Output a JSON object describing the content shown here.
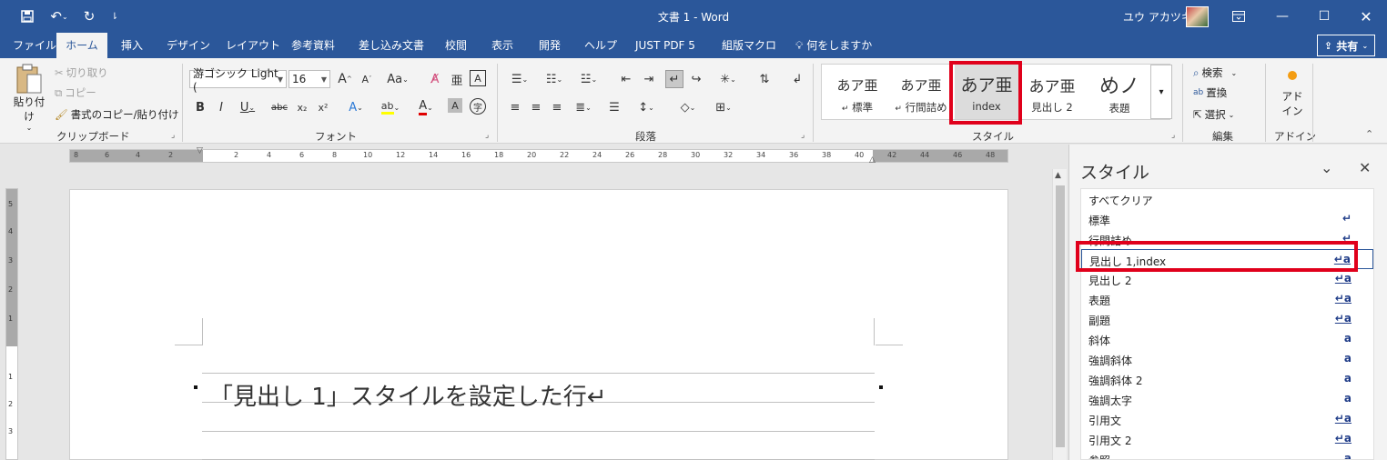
{
  "titlebar": {
    "doc_title": "文書 1  -  Word",
    "user": "ユウ アカツキ",
    "qa_icons": [
      "save-icon",
      "undo-icon",
      "redo-icon",
      "customize-icon"
    ],
    "window_buttons": [
      "ribbon-display-icon",
      "minimize-icon",
      "maximize-icon",
      "close-icon"
    ]
  },
  "tabs": [
    "ファイル",
    "ホーム",
    "挿入",
    "デザイン",
    "レイアウト",
    "参考資料",
    "差し込み文書",
    "校閲",
    "表示",
    "開発",
    "ヘルプ",
    "JUST PDF 5",
    "組版マクロ",
    "何をしますか"
  ],
  "active_tab": "ホーム",
  "share_label": "共有",
  "ribbon": {
    "clipboard": {
      "paste": "貼り付け",
      "cut": "切り取り",
      "copy": "コピー",
      "format_painter": "書式のコピー/貼り付け",
      "group_label": "クリップボード"
    },
    "font": {
      "font_name": "游ゴシック Light (",
      "font_size": "16",
      "group_label": "フォント"
    },
    "paragraph": {
      "group_label": "段落"
    },
    "styles": {
      "group_label": "スタイル",
      "gallery": [
        {
          "preview": "あア亜",
          "name": "標準"
        },
        {
          "preview": "あア亜",
          "name": "行間詰め"
        },
        {
          "preview": "あア亜",
          "name": "index"
        },
        {
          "preview": "あア亜",
          "name": "見出し 2"
        },
        {
          "preview": "めノ",
          "name": "表題"
        }
      ]
    },
    "editing": {
      "find": "検索",
      "replace": "置換",
      "select": "選択",
      "group_label": "編集"
    },
    "addin": {
      "label1": "アド",
      "label2": "イン",
      "group_label": "アドイン"
    }
  },
  "ruler": {
    "left_ticks": [
      "8",
      "6",
      "4",
      "2"
    ],
    "ticks": [
      "2",
      "4",
      "6",
      "8",
      "10",
      "12",
      "14",
      "16",
      "18",
      "20",
      "22",
      "24",
      "26",
      "28",
      "30",
      "32",
      "34",
      "36",
      "38",
      "40"
    ],
    "right_ticks": [
      "42",
      "44",
      "46",
      "48"
    ],
    "vertical_ticks": [
      "5",
      "4",
      "3",
      "2",
      "1",
      "1",
      "2",
      "3"
    ]
  },
  "document": {
    "line_text": "「見出し 1」スタイルを設定した行↵"
  },
  "styles_pane": {
    "title": "スタイル",
    "items": [
      {
        "name": "すべてクリア",
        "type": ""
      },
      {
        "name": "標準",
        "type": "↵"
      },
      {
        "name": "行間詰め",
        "type": "↵"
      },
      {
        "name": "見出し 1,index",
        "type": "↵a"
      },
      {
        "name": "見出し 2",
        "type": "↵a"
      },
      {
        "name": "表題",
        "type": "↵a"
      },
      {
        "name": "副題",
        "type": "↵a"
      },
      {
        "name": "斜体",
        "type": "a"
      },
      {
        "name": "強調斜体",
        "type": "a"
      },
      {
        "name": "強調斜体 2",
        "type": "a"
      },
      {
        "name": "強調太字",
        "type": "a"
      },
      {
        "name": "引用文",
        "type": "↵a"
      },
      {
        "name": "引用文 2",
        "type": "↵a"
      },
      {
        "name": "参照",
        "type": "a"
      }
    ],
    "selected": "見出し 1,index"
  },
  "colors": {
    "brand": "#2b579a",
    "highlight": "#e0001b"
  }
}
